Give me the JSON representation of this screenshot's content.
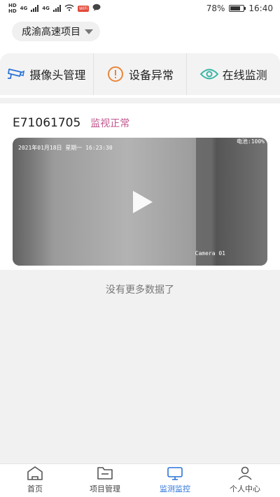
{
  "status_bar": {
    "hd1": "HD",
    "hd2": "HD",
    "net1": "4G",
    "net2": "4G",
    "notif_badge": "WiFi",
    "battery_percent": "78%",
    "time": "16:40",
    "battery_level": 0.78
  },
  "header": {
    "project_name": "成渝高速项目"
  },
  "tabs": [
    {
      "label": "摄像头管理",
      "icon": "camera-icon"
    },
    {
      "label": "设备异常",
      "icon": "alert-icon"
    },
    {
      "label": "在线监测",
      "icon": "eye-icon"
    }
  ],
  "device": {
    "id": "E71061705",
    "status": "监视正常",
    "osd_time": "2021年01月18日 星期一 16:23:30",
    "osd_battery": "电池:100%",
    "osd_camera": "Camera 01"
  },
  "list_end_text": "没有更多数据了",
  "bottom_nav": [
    {
      "label": "首页",
      "icon": "home-icon",
      "active": false
    },
    {
      "label": "项目管理",
      "icon": "folder-icon",
      "active": false
    },
    {
      "label": "监测监控",
      "icon": "monitor-icon",
      "active": true
    },
    {
      "label": "个人中心",
      "icon": "user-icon",
      "active": false
    }
  ],
  "colors": {
    "accent": "#2b73d9",
    "status_pink": "#c0568e",
    "alert_orange": "#e8873a",
    "eye_teal": "#3ab5a5"
  }
}
